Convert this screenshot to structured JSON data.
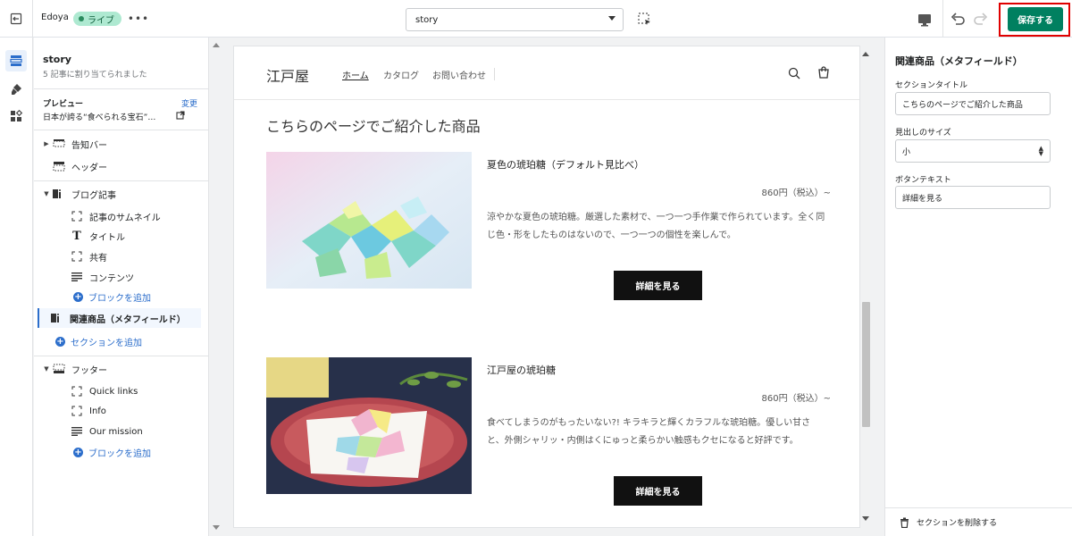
{
  "topbar": {
    "store_name": "Edoya",
    "live_badge": "ライブ",
    "more": "•••",
    "page_select": "story",
    "save_label": "保存する"
  },
  "sidebar": {
    "title": "story",
    "subtitle": "5 記事に割り当てられました",
    "preview_label": "プレビュー",
    "change_link": "変更",
    "preview_value": "日本が誇る“食べられる宝石”…",
    "tree": [
      {
        "label": "告知バー",
        "icon": "announcement-bar-icon"
      },
      {
        "label": "ヘッダー",
        "icon": "header-icon"
      },
      {
        "label": "ブログ記事",
        "icon": "blog-post-icon"
      },
      {
        "label": "記事のサムネイル",
        "icon": "image-block-icon"
      },
      {
        "label": "タイトル",
        "icon": "text-icon"
      },
      {
        "label": "共有",
        "icon": "share-block-icon"
      },
      {
        "label": "コンテンツ",
        "icon": "content-icon"
      },
      {
        "label": "ブロックを追加",
        "icon": "add-circle-icon"
      },
      {
        "label": "関連商品（メタフィールド）",
        "icon": "section-icon"
      },
      {
        "label": "セクションを追加",
        "icon": "add-circle-icon"
      },
      {
        "label": "フッター",
        "icon": "footer-icon"
      },
      {
        "label": "Quick links",
        "icon": "block-icon"
      },
      {
        "label": "Info",
        "icon": "block-icon"
      },
      {
        "label": "Our mission",
        "icon": "text-block-icon"
      },
      {
        "label": "ブロックを追加",
        "icon": "add-circle-icon"
      }
    ]
  },
  "preview": {
    "logo": "江戸屋",
    "nav": [
      "ホーム",
      "カタログ",
      "お問い合わせ"
    ],
    "section_heading": "こちらのページでご紹介した商品",
    "products": [
      {
        "title": "夏色の琥珀糖（デフォルト見比べ）",
        "price": "860円（税込）~",
        "description": "涼やかな夏色の琥珀糖。厳選した素材で、一つ一つ手作業で作られています。全く同じ色・形をしたものはないので、一つ一つの個性を楽しんで。",
        "button": "詳細を見る"
      },
      {
        "title": "江戸屋の琥珀糖",
        "price": "860円（税込）~",
        "description": "食べてしまうのがもったいない?! キラキラと輝くカラフルな琥珀糖。優しい甘さと、外側シャリッ・内側はくにゅっと柔らかい触感もクセになると好評です。",
        "button": "詳細を見る"
      }
    ]
  },
  "settings": {
    "title": "関連商品（メタフィールド）",
    "section_title_label": "セクションタイトル",
    "section_title_value": "こちらのページでご紹介した商品",
    "heading_size_label": "見出しのサイズ",
    "heading_size_value": "小",
    "button_text_label": "ボタンテキスト",
    "button_text_value": "詳細を見る",
    "delete_section": "セクションを削除する"
  },
  "colors": {
    "save_button": "#008060",
    "highlight": "#e00000",
    "link": "#2c6ecb",
    "live_badge": "#aee9d1"
  }
}
